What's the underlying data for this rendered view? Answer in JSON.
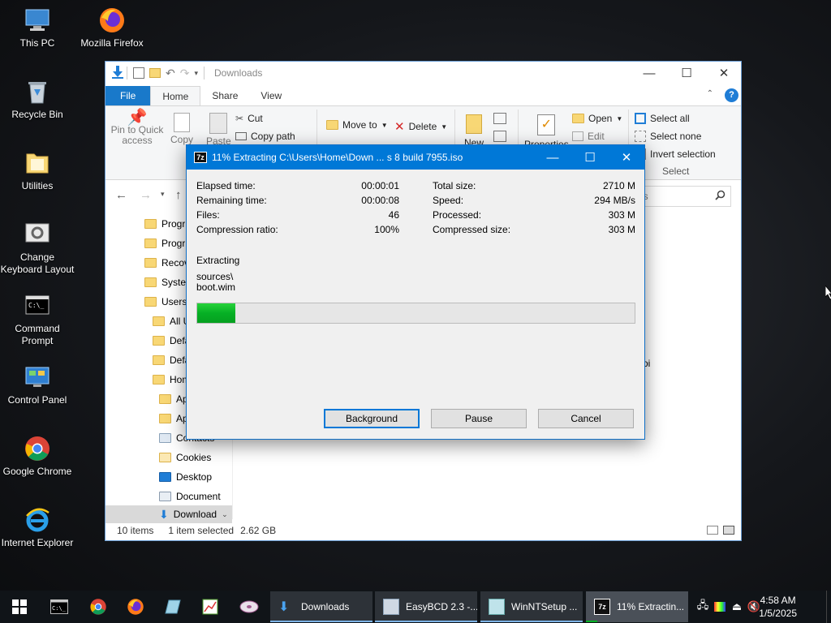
{
  "desktop": {
    "icons": [
      {
        "label": "This PC"
      },
      {
        "label": "Mozilla Firefox"
      },
      {
        "label": "Recycle Bin"
      },
      {
        "label": "Utilities"
      },
      {
        "label": "Change Keyboard Layout"
      },
      {
        "label": "Command Prompt"
      },
      {
        "label": "Control Panel"
      },
      {
        "label": "Google Chrome"
      },
      {
        "label": "Internet Explorer"
      }
    ]
  },
  "explorer": {
    "title": "Downloads",
    "tabs": {
      "file": "File",
      "home": "Home",
      "share": "Share",
      "view": "View"
    },
    "ribbon": {
      "pin": "Pin to Quick access",
      "copy": "Copy",
      "paste": "Paste",
      "cut": "Cut",
      "copy_path": "Copy path",
      "move_to": "Move to",
      "delete": "Delete",
      "new": "New",
      "properties": "Properties",
      "open": "Open",
      "edit": "Edit",
      "select_all": "Select all",
      "select_none": "Select none",
      "invert_selection": "Invert selection",
      "select_group": "Select"
    },
    "search_text": "ds",
    "nav_tree": [
      {
        "label": "Progr"
      },
      {
        "label": "Progr"
      },
      {
        "label": "Recov"
      },
      {
        "label": "Syster"
      },
      {
        "label": "Users"
      },
      {
        "label": "All U"
      },
      {
        "label": "Defa"
      },
      {
        "label": "Defa"
      },
      {
        "label": "Hom"
      },
      {
        "label": "Ap"
      },
      {
        "label": "Ap"
      },
      {
        "label": "Contacts"
      },
      {
        "label": "Cookies"
      },
      {
        "label": "Desktop"
      },
      {
        "label": "Document"
      },
      {
        "label": "Download"
      }
    ],
    "content_fragment": "oi",
    "status": {
      "items": "10 items",
      "selected": "1 item selected",
      "size": "2.62 GB"
    }
  },
  "dialog": {
    "title": "11% Extracting C:\\Users\\Home\\Down ... s 8 build 7955.iso",
    "left": {
      "elapsed_label": "Elapsed time:",
      "elapsed": "00:00:01",
      "remaining_label": "Remaining time:",
      "remaining": "00:00:08",
      "files_label": "Files:",
      "files": "46",
      "ratio_label": "Compression ratio:",
      "ratio": "100%"
    },
    "right": {
      "total_label": "Total size:",
      "total": "2710 M",
      "speed_label": "Speed:",
      "speed": "294 MB/s",
      "processed_label": "Processed:",
      "processed": "303 M",
      "compressed_label": "Compressed size:",
      "compressed": "303 M"
    },
    "action": "Extracting",
    "path_line1": "sources\\",
    "path_line2": "boot.wim",
    "progress_fraction": 0.088,
    "buttons": {
      "background": "Background",
      "pause": "Pause",
      "cancel": "Cancel"
    }
  },
  "taskbar": {
    "tasks": [
      {
        "label": "Downloads"
      },
      {
        "label": "EasyBCD 2.3 -..."
      },
      {
        "label": "WinNTSetup ..."
      },
      {
        "label": "11% Extractin..."
      }
    ],
    "time": "4:58 AM",
    "date": "1/5/2025"
  },
  "colors": {
    "accent": "#0078d7",
    "progress": "#06b025",
    "taskbar": "#101418"
  }
}
